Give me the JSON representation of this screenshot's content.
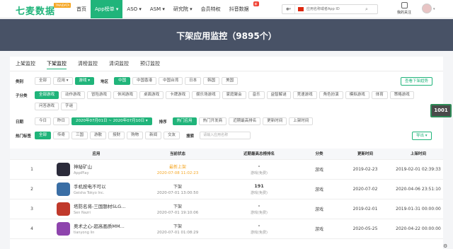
{
  "brand": {
    "name": "七麦数据",
    "badge": "7MAIDATA"
  },
  "nav": {
    "items": [
      {
        "label": "首页",
        "active": false
      },
      {
        "label": "App榜单 ▾",
        "active": true
      },
      {
        "label": "ASO ▾",
        "active": false
      },
      {
        "label": "ASM ▾",
        "active": false
      },
      {
        "label": "研究院 ▾",
        "active": false
      },
      {
        "label": "会员特权",
        "active": false
      },
      {
        "label": "抖音数据",
        "active": false,
        "badge": "新"
      }
    ]
  },
  "search": {
    "platform": "",
    "placeholder": "应用名称或者App ID"
  },
  "user": {
    "follow_label": "我的关注"
  },
  "banner": {
    "title": "下架应用监控（9895个）"
  },
  "tabs": [
    "上架监控",
    "下架监控",
    "清榜监控",
    "清词监控",
    "预订监控"
  ],
  "active_tab": 1,
  "filters": {
    "category": {
      "label": "类别",
      "options": [
        "全部",
        "应用 ▾",
        "游戏 ▾"
      ],
      "selected": 2
    },
    "region": {
      "label": "地区",
      "options": [
        "中国",
        "中国香港",
        "中国台湾",
        "日本",
        "韩国",
        "美国"
      ],
      "selected": 0
    },
    "subcat": {
      "label": "子分类",
      "options": [
        "全部游戏",
        "动作游戏",
        "冒险游戏",
        "休闲游戏",
        "桌面游戏",
        "卡牌游戏",
        "娱乐场游戏",
        "家庭聚会",
        "音乐",
        "益智解谜",
        "竞速游戏",
        "角色扮演",
        "模拟游戏",
        "体育",
        "策略游戏",
        "问答游戏",
        "字谜"
      ],
      "selected": 0
    },
    "date": {
      "label": "日期",
      "options": [
        "今日",
        "昨日"
      ],
      "range": "2020年07月01日 ~ 2020年07月10日 ▾"
    },
    "sort": {
      "label": "排序",
      "options": [
        "热门应用",
        "热门开发商",
        "近期最高排名",
        "更新时间",
        "上架时间"
      ],
      "selected": 0
    },
    "tags": {
      "label": "热门标签",
      "options": [
        "全部",
        "传奇",
        "三国",
        "游散",
        "授财",
        "购物",
        "新闻",
        "交友"
      ],
      "selected": 0
    },
    "keyword": {
      "label": "搜索",
      "placeholder": "请输入应用名称"
    }
  },
  "buttons": {
    "view_trend": "查看下架趋势",
    "export": "导出 ▾"
  },
  "table": {
    "headers": [
      "",
      "应用",
      "当前状态",
      "近期最高总榜排名",
      "分类",
      "更新时间",
      "上架时间"
    ],
    "rows": [
      {
        "idx": "1",
        "name": "神秘矿山",
        "dev": "AppiPlay",
        "status": "最新上架",
        "status_time": "2020-07-08 11:02:23",
        "status_color": "orange",
        "rank": "-",
        "rank_label": "游戏(免费)",
        "category": "游戏",
        "updated": "2019-02-23",
        "released": "2019-02-01 02:39:33",
        "icon_color": "#2b2b3a"
      },
      {
        "idx": "2",
        "name": "手机按电不可以",
        "dev": "Geisha Tokyo Inc.",
        "status": "下架",
        "status_time": "2020-07-01 13:00:50",
        "status_color": "gray",
        "rank": "191",
        "rank_label": "游戏(免费)",
        "category": "游戏",
        "updated": "2020-07-02",
        "released": "2020-04-06 23:51:10",
        "icon_color": "#3a6ea5"
      },
      {
        "idx": "3",
        "name": "塔防名将-三国题材SLG...",
        "dev": "Sen Nazri",
        "status": "下架",
        "status_time": "2020-07-01 19:10:06",
        "status_color": "gray",
        "rank": "-",
        "rank_label": "游戏(免费)",
        "category": "游戏",
        "updated": "2019-02-01",
        "released": "2019-01-31 00:00:00",
        "icon_color": "#c0392b"
      },
      {
        "idx": "4",
        "name": "奥术之心-超高画质MM...",
        "dev": "tianyong lin",
        "status": "下架",
        "status_time": "2020-07-01 01:08:29",
        "status_color": "gray",
        "rank": "-",
        "rank_label": "游戏(免费)",
        "category": "游戏",
        "updated": "2020-05-25",
        "released": "2020-04-22 00:00:00",
        "icon_color": "#8e44ad"
      }
    ]
  },
  "side_widget": {
    "label": "1001间"
  },
  "colors": {
    "accent": "#20b47a",
    "banner": "#485266",
    "warning": "#f5a623"
  }
}
